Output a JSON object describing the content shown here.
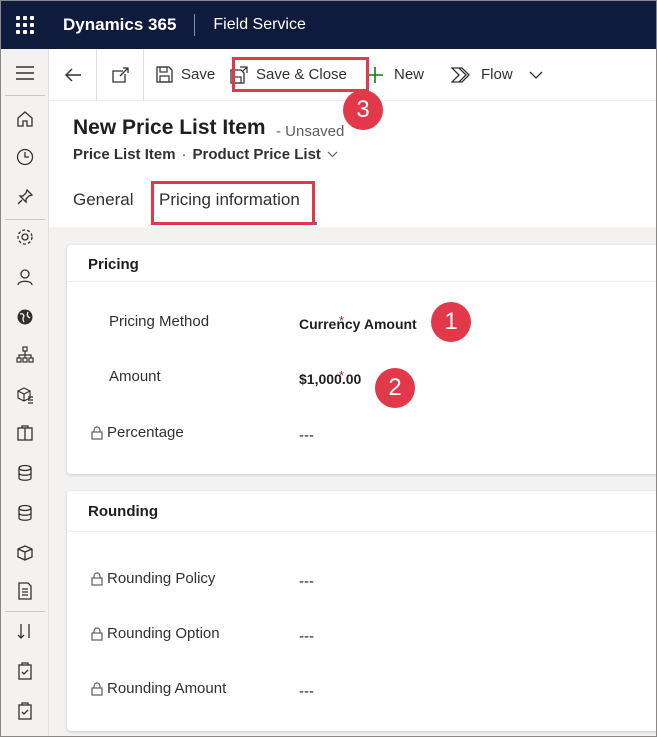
{
  "topbar": {
    "brand": "Dynamics 365",
    "app": "Field Service"
  },
  "command_bar": {
    "save": "Save",
    "save_close": "Save & Close",
    "new": "New",
    "flow": "Flow"
  },
  "header": {
    "title": "New Price List Item",
    "status": "- Unsaved",
    "entity": "Price List Item",
    "form_selector": "Product Price List"
  },
  "tabs": [
    {
      "label": "General"
    },
    {
      "label": "Pricing information"
    }
  ],
  "pricing": {
    "title": "Pricing",
    "method_label": "Pricing Method",
    "method_value": "Currency Amount",
    "amount_label": "Amount",
    "amount_value": "$1,000.00",
    "percentage_label": "Percentage",
    "percentage_value": "---",
    "required_marker": "*"
  },
  "rounding": {
    "title": "Rounding",
    "policy_label": "Rounding Policy",
    "policy_value": "---",
    "option_label": "Rounding Option",
    "option_value": "---",
    "amount_label": "Rounding Amount",
    "amount_value": "---"
  },
  "callouts": [
    "1",
    "2",
    "3"
  ],
  "colors": {
    "topbar": "#0f1b3d",
    "highlight": "#e3384a",
    "tab_underline": "#4f6bed",
    "required": "#a4262c"
  },
  "left_nav_icons": [
    "home-icon",
    "recent-icon",
    "pin-icon",
    "settings-icon",
    "person-icon",
    "globe-icon",
    "org-chart-icon",
    "product-box-icon",
    "clipboard-icon",
    "database-icon",
    "database-icon",
    "cube-icon",
    "document-icon",
    "sort-icon",
    "checklist-icon",
    "checklist-icon"
  ]
}
